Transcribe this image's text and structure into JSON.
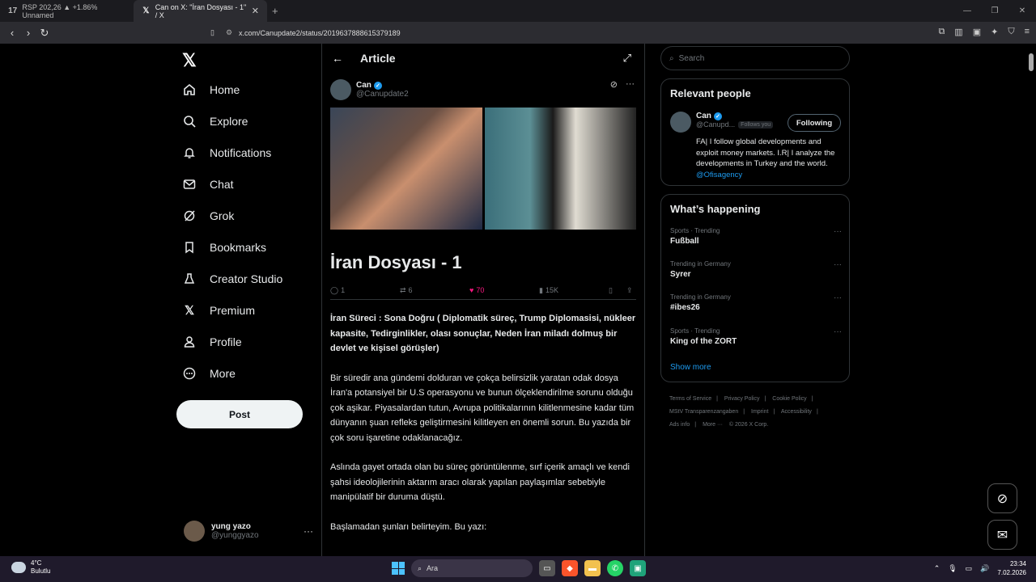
{
  "browser": {
    "tabs": [
      {
        "icon": "tv-icon",
        "label": "RSP 202,26 ▲ +1.86% Unnamed"
      },
      {
        "icon": "x-icon",
        "label": "Can on X: \"İran Dosyası - 1\" / X"
      }
    ],
    "url": "x.com/Canupdate2/status/2019637888615379189"
  },
  "nav": {
    "items": [
      {
        "label": "Home"
      },
      {
        "label": "Explore"
      },
      {
        "label": "Notifications"
      },
      {
        "label": "Chat"
      },
      {
        "label": "Grok"
      },
      {
        "label": "Bookmarks"
      },
      {
        "label": "Creator Studio"
      },
      {
        "label": "Premium"
      },
      {
        "label": "Profile"
      },
      {
        "label": "More"
      }
    ],
    "post_label": "Post",
    "me_name": "yung yazo",
    "me_handle": "@yunggyazo"
  },
  "article": {
    "header": "Article",
    "author_name": "Can",
    "author_handle": "@Canupdate2",
    "title": "İran Dosyası - 1",
    "stats": {
      "replies": "1",
      "reposts": "6",
      "likes": "70",
      "views": "15K"
    },
    "paragraphs": [
      {
        "bold": true,
        "text": "İran Süreci : Sona Doğru ( Diplomatik süreç, Trump Diplomasisi, nükleer kapasite, Tedirginlikler, olası sonuçlar, Neden İran miladı dolmuş bir devlet ve kişisel görüşler)"
      },
      {
        "bold": false,
        "text": "Bir süredir ana gündemi dolduran ve çokça belirsizlik yaratan odak dosya İran'a potansiyel bir U.S operasyonu ve bunun ölçeklendirilme sorunu olduğu çok aşikar. Piyasalardan tutun, Avrupa politikalarının kilitlenmesine kadar tüm dünyanın şuan refleks geliştirmesini kilitleyen en önemli sorun. Bu yazıda bir çok soru işaretine  odaklanacağız."
      },
      {
        "bold": false,
        "text": "Aslında gayet ortada olan bu süreç  görüntülenme, sırf içerik amaçlı ve kendi şahsi ideolojilerinin aktarım aracı olarak yapılan paylaşımlar sebebiyle manipülatif bir duruma düştü."
      },
      {
        "bold": false,
        "text": "Başlamadan şunları belirteyim. Bu yazı:"
      }
    ]
  },
  "sidebar": {
    "search_placeholder": "Search",
    "relevant_title": "Relevant people",
    "rp_name": "Can",
    "rp_handle": "@Canupd...",
    "rp_follows": "Follows you",
    "rp_button": "Following",
    "rp_bio": "FA| I follow global developments and exploit money markets. I.R| I analyze the developments in Turkey and the world.",
    "rp_bio_link": "@Ofisagency",
    "happening_title": "What’s happening",
    "trends": [
      {
        "category": "Sports · Trending",
        "name": "Fußball"
      },
      {
        "category": "Trending in Germany",
        "name": "Syrer"
      },
      {
        "category": "Trending in Germany",
        "name": "#ibes26"
      },
      {
        "category": "Sports · Trending",
        "name": "King of the ZORT"
      }
    ],
    "show_more": "Show more",
    "footer": [
      "Terms of Service",
      "|",
      "Privacy Policy",
      "|",
      "Cookie Policy",
      "|",
      "MStV Transparenzangaben",
      "|",
      "Imprint",
      "|",
      "Accessibility",
      "|",
      "Ads info",
      "|",
      "More ···",
      "© 2026 X Corp."
    ]
  },
  "taskbar": {
    "temp": "4°C",
    "weather": "Bulutlu",
    "search": "Ara",
    "time": "23:34",
    "date": "7.02.2026"
  }
}
